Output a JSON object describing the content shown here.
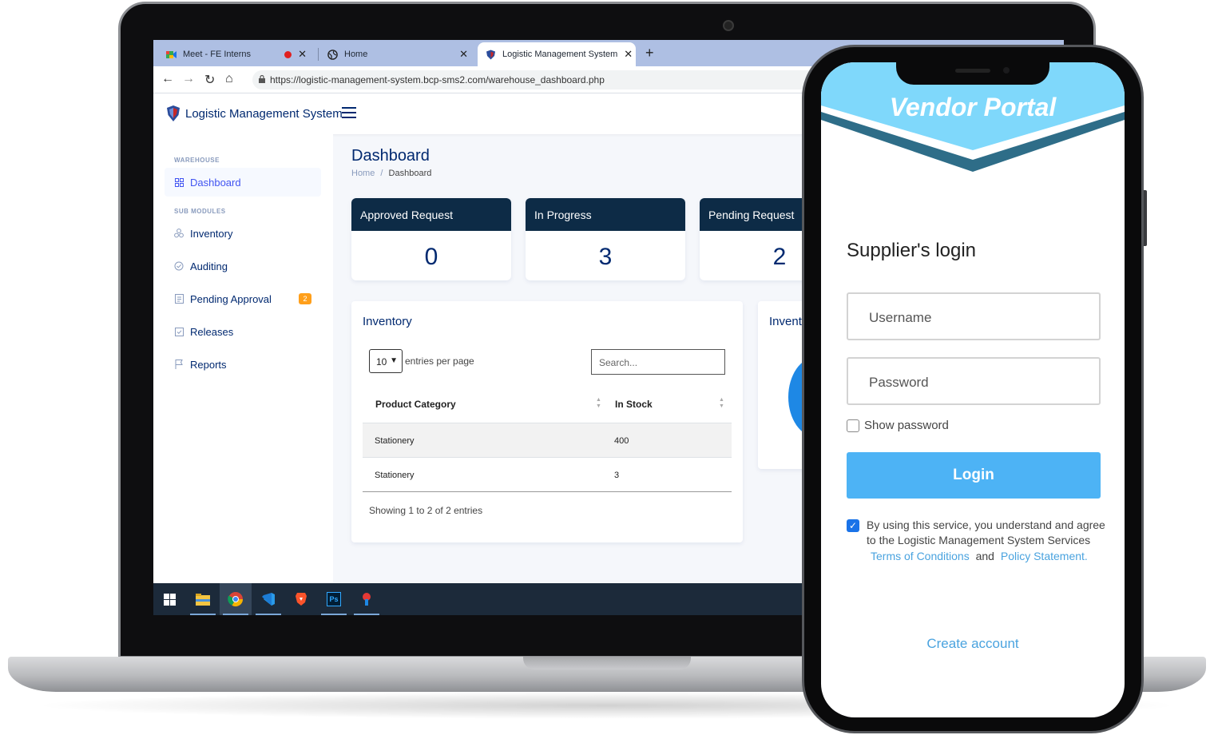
{
  "browser": {
    "tabs": [
      {
        "label": "Meet - FE Interns"
      },
      {
        "label": "Home"
      },
      {
        "label": "Logistic Management System"
      }
    ],
    "url": "https://logistic-management-system.bcp-sms2.com/warehouse_dashboard.php"
  },
  "app": {
    "brand": "Logistic Management System"
  },
  "sidebar": {
    "section_warehouse": "WAREHOUSE",
    "section_sub": "SUB MODULES",
    "items": [
      {
        "label": "Dashboard",
        "icon": "grid-icon"
      },
      {
        "label": "Inventory",
        "icon": "boxes-icon"
      },
      {
        "label": "Auditing",
        "icon": "check-circle-icon"
      },
      {
        "label": "Pending Approval",
        "icon": "document-icon",
        "badge": "2"
      },
      {
        "label": "Releases",
        "icon": "check-square-icon"
      },
      {
        "label": "Reports",
        "icon": "flag-icon"
      }
    ]
  },
  "main": {
    "title": "Dashboard",
    "breadcrumb": {
      "home": "Home",
      "sep": "/",
      "current": "Dashboard"
    },
    "cards": [
      {
        "label": "Approved Request",
        "value": "0"
      },
      {
        "label": "In Progress",
        "value": "3"
      },
      {
        "label": "Pending Request",
        "value": "2"
      }
    ],
    "inventory": {
      "title": "Inventory",
      "entries_value": "10",
      "entries_label": "entries per page",
      "search_placeholder": "Search...",
      "columns": [
        "Product Category",
        "In Stock"
      ],
      "rows": [
        {
          "category": "Stationery",
          "stock": "400"
        },
        {
          "category": "Stationery",
          "stock": "3"
        }
      ],
      "footer": "Showing 1 to 2 of 2 entries"
    },
    "second_panel_title": "Invent"
  },
  "taskbar": {
    "apps": [
      "windows-start-icon",
      "file-explorer-icon",
      "chrome-icon",
      "vscode-icon",
      "brave-icon",
      "photoshop-icon",
      "app-icon"
    ]
  },
  "phone": {
    "portal_title": "Vendor Portal",
    "heading": "Supplier's login",
    "username_placeholder": "Username",
    "password_placeholder": "Password",
    "show_password": "Show password",
    "login_button": "Login",
    "agree_text": "By using this service, you understand and agree to the Logistic Management System Services",
    "terms_link": "Terms of Conditions",
    "and_text": "and",
    "policy_link": "Policy Statement.",
    "create_account": "Create account"
  },
  "colors": {
    "navy": "#012970",
    "card_head": "#0d2b46",
    "accent_blue": "#4154f1",
    "login_blue": "#4db3f5",
    "banner_light": "#7fd8fb",
    "banner_dark": "#2e6d88",
    "badge": "#ff9f1a"
  }
}
